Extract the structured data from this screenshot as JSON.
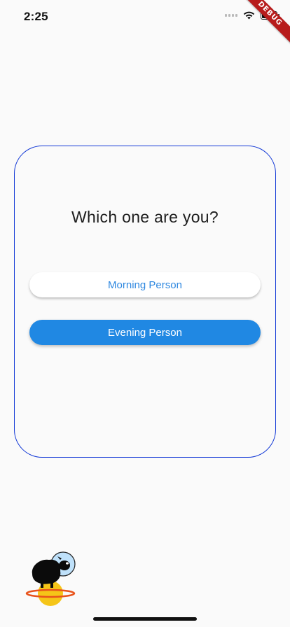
{
  "status_bar": {
    "time": "2:25"
  },
  "debug_banner": {
    "label": "DEBUG",
    "color": "#b71c1c"
  },
  "card": {
    "title": "Which one are you?",
    "border_color": "#1238d6",
    "options": [
      {
        "label": "Morning Person",
        "style": "outlined"
      },
      {
        "label": "Evening Person",
        "style": "filled"
      }
    ]
  },
  "colors": {
    "accent": "#2088e3",
    "background": "#fafafa"
  },
  "icons": {
    "mascot": "astronaut-sheep-on-planet-icon"
  }
}
